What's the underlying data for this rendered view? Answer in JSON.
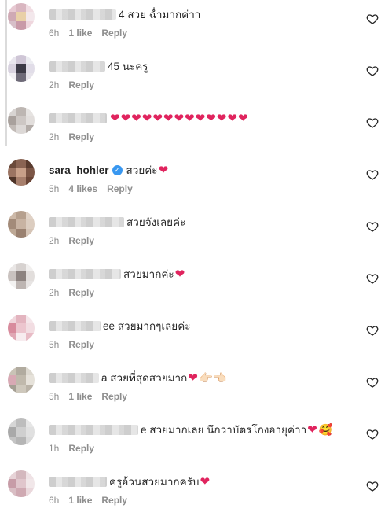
{
  "comments": [
    {
      "blur_width": 86,
      "text": "4 สวย ฉ่ำมากค่าา",
      "hearts": 0,
      "emoji": "",
      "time": "6h",
      "likes": "1 like",
      "reply": "Reply",
      "avatar_colors": [
        "#e7c9d2",
        "#d9b6c0",
        "#f1dde3",
        "#cfa9b4",
        "#e9d0a8",
        "#f3e8ec",
        "#d7bfc8",
        "#c99aa8",
        "#efd7de"
      ]
    },
    {
      "blur_width": 72,
      "text": "45 นะครู",
      "hearts": 0,
      "emoji": "",
      "time": "2h",
      "likes": "",
      "reply": "Reply",
      "avatar_colors": [
        "#e9e6ee",
        "#cfc6d6",
        "#ececf1",
        "#d8d2df",
        "#3c3a46",
        "#e1dde8",
        "#f0eef3",
        "#6e6a78",
        "#e6e3ea"
      ]
    },
    {
      "blur_width": 74,
      "text": "",
      "hearts": 13,
      "emoji": "",
      "time": "2h",
      "likes": "",
      "reply": "Reply",
      "avatar_colors": [
        "#d8d4d2",
        "#bdb6b2",
        "#e6e3e1",
        "#a9a19d",
        "#cdc7c4",
        "#e2dedc",
        "#c2bbb7",
        "#dcd8d6",
        "#b3aca8"
      ]
    },
    {
      "username": "sara_hohler",
      "verified": true,
      "text": "สวยค่ะ",
      "hearts": 1,
      "emoji": "",
      "time": "5h",
      "likes": "4 likes",
      "reply": "Reply",
      "avatar_colors": [
        "#6b4a3a",
        "#8a6453",
        "#5a3c2f",
        "#9b7462",
        "#c8a089",
        "#7c5646",
        "#4e3428",
        "#a77f6c",
        "#6a4536"
      ]
    },
    {
      "blur_width": 96,
      "text": "สวยจังเลยค่ะ",
      "hearts": 0,
      "emoji": "",
      "time": "2h",
      "likes": "",
      "reply": "Reply",
      "avatar_colors": [
        "#cdb9a8",
        "#b6a08e",
        "#e0d2c6",
        "#a38b79",
        "#c8b3a2",
        "#dccdc0",
        "#bda895",
        "#9a8170",
        "#d5c4b6"
      ]
    },
    {
      "blur_width": 92,
      "text": "สวยมากค่ะ",
      "hearts": 1,
      "emoji": "",
      "time": "2h",
      "likes": "",
      "reply": "Reply",
      "avatar_colors": [
        "#eae7e6",
        "#d7d2d0",
        "#f1efee",
        "#c9c2bf",
        "#8d8380",
        "#e2dedc",
        "#f3f2f1",
        "#bdb5b2",
        "#e7e4e3"
      ]
    },
    {
      "blur_width": 66,
      "text": "ee สวยมากๆเลยค่ะ",
      "hearts": 0,
      "emoji": "",
      "time": "5h",
      "likes": "",
      "reply": "Reply",
      "avatar_colors": [
        "#f0d6dc",
        "#e3b4bf",
        "#f5e6ea",
        "#d88b9d",
        "#ecc5ce",
        "#f2dde2",
        "#e0a7b4",
        "#f7ecef",
        "#e8bcc6"
      ]
    },
    {
      "blur_width": 64,
      "text": "a สวยที่สุดสวยมาก",
      "hearts": 1,
      "emoji": "👉🏻👈🏻",
      "time": "5h",
      "likes": "1 like",
      "reply": "Reply",
      "avatar_colors": [
        "#c9c3b6",
        "#b1ab9f",
        "#ddd9d0",
        "#d8a9b4",
        "#c0b9ac",
        "#e6e2da",
        "#a59f94",
        "#cec8bc",
        "#bab3a7"
      ]
    },
    {
      "blur_width": 114,
      "text": "e สวยมากเลย นึกว่าบัตรโกงอายุค่าา",
      "hearts": 1,
      "emoji": "🥰",
      "time": "1h",
      "likes": "",
      "reply": "Reply",
      "avatar_colors": [
        "#d6d6d6",
        "#bdbdbd",
        "#e6e6e6",
        "#a9a9a9",
        "#cfcfcf",
        "#e0e0e0",
        "#c4c4c4",
        "#b5b5b5",
        "#dadada"
      ]
    },
    {
      "blur_width": 74,
      "text": "ครูอ้วนสวยมากครับ",
      "hearts": 1,
      "emoji": "",
      "time": "6h",
      "likes": "1 like",
      "reply": "Reply",
      "avatar_colors": [
        "#e7d3d7",
        "#d4b8be",
        "#efe2e5",
        "#c79ca7",
        "#e0c6cc",
        "#f1e7e9",
        "#d9bec4",
        "#cfa9b2",
        "#ead8dc"
      ]
    }
  ]
}
